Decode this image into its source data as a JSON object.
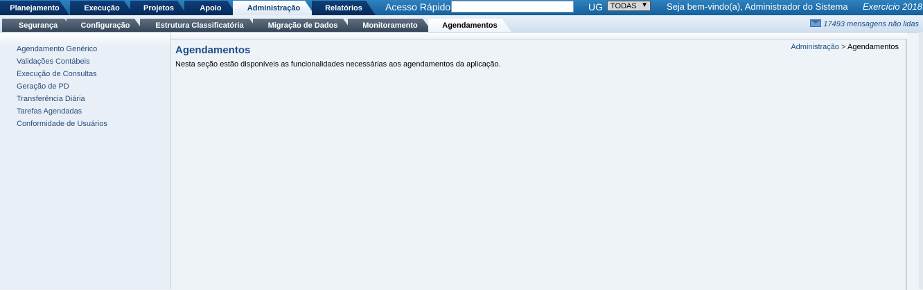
{
  "top_tabs": [
    {
      "label": "Planejamento",
      "active": false
    },
    {
      "label": "Execução",
      "active": false
    },
    {
      "label": "Projetos",
      "active": false
    },
    {
      "label": "Apoio",
      "active": false
    },
    {
      "label": "Administração",
      "active": true
    },
    {
      "label": "Relatórios",
      "active": false
    }
  ],
  "quick_access": {
    "label": "Acesso Rápido",
    "value": "",
    "placeholder": ""
  },
  "ug": {
    "label": "UG",
    "selected": "TODAS"
  },
  "welcome": "Seja bem-vindo(a), Administrador do Sistema",
  "exercicio": "Exercício 2018",
  "sub_tabs": [
    {
      "label": "Segurança",
      "active": false
    },
    {
      "label": "Configuração",
      "active": false
    },
    {
      "label": "Estrutura Classificatória",
      "active": false
    },
    {
      "label": "Migração de Dados",
      "active": false
    },
    {
      "label": "Monitoramento",
      "active": false
    },
    {
      "label": "Agendamentos",
      "active": true
    }
  ],
  "messages": "17493 mensagens não lidas",
  "sidebar": {
    "items": [
      {
        "label": "Agendamento Genérico"
      },
      {
        "label": "Validações Contábeis"
      },
      {
        "label": "Execução de Consultas"
      },
      {
        "label": "Geração de PD"
      },
      {
        "label": "Transferência Diária"
      },
      {
        "label": "Tarefas Agendadas"
      },
      {
        "label": "Conformidade de Usuários"
      }
    ]
  },
  "main": {
    "title": "Agendamentos",
    "description": "Nesta seção estão disponíveis as funcionalidades necessárias aos agendamentos da aplicação.",
    "breadcrumb": {
      "link": "Administração",
      "separator": ">",
      "current": "Agendamentos"
    }
  },
  "colors": {
    "top_bar": "#14609d",
    "tab_dark": "#062a58",
    "link": "#1d4d86"
  },
  "icons": {
    "messages": "mail-icon",
    "ug_dropdown": "chevron-down-icon"
  }
}
